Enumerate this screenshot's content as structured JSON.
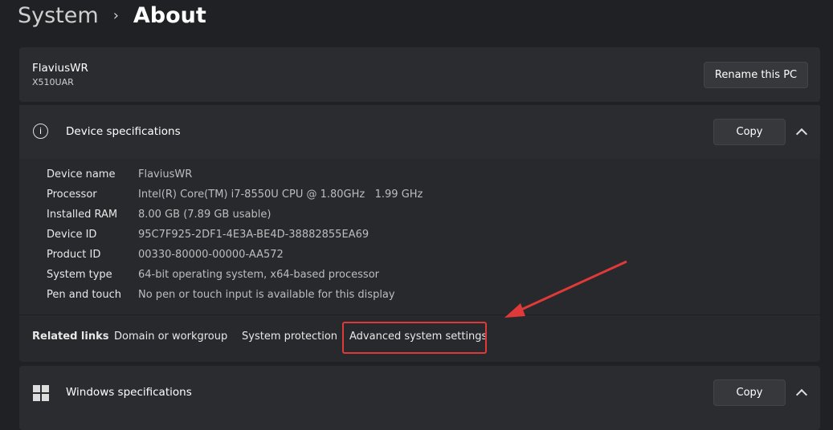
{
  "breadcrumb": {
    "parent": "System",
    "current": "About"
  },
  "pc": {
    "name": "FlaviusWR",
    "model": "X510UAR",
    "rename_label": "Rename this PC"
  },
  "device_specs": {
    "title": "Device specifications",
    "copy_label": "Copy",
    "rows": [
      {
        "label": "Device name",
        "value": "FlaviusWR"
      },
      {
        "label": "Processor",
        "value": "Intel(R) Core(TM) i7-8550U CPU @ 1.80GHz   1.99 GHz"
      },
      {
        "label": "Installed RAM",
        "value": "8.00 GB (7.89 GB usable)"
      },
      {
        "label": "Device ID",
        "value": "95C7F925-2DF1-4E3A-BE4D-38882855EA69"
      },
      {
        "label": "Product ID",
        "value": "00330-80000-00000-AA572"
      },
      {
        "label": "System type",
        "value": "64-bit operating system, x64-based processor"
      },
      {
        "label": "Pen and touch",
        "value": "No pen or touch input is available for this display"
      }
    ]
  },
  "related": {
    "label": "Related links",
    "links": [
      "Domain or workgroup",
      "System protection",
      "Advanced system settings"
    ]
  },
  "windows_specs": {
    "title": "Windows specifications",
    "copy_label": "Copy"
  },
  "annotation_color": "#e0393a"
}
